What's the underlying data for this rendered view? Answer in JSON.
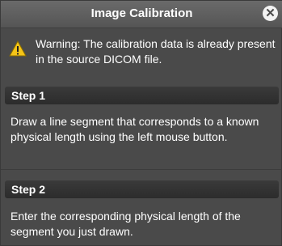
{
  "dialog": {
    "title": "Image Calibration",
    "close_symbol": "✕",
    "close_icon": "close-icon"
  },
  "warning": {
    "icon": "warning-icon",
    "icon_color": "#f5c518",
    "text": "Warning: The calibration data is already present in the source DICOM file."
  },
  "steps": [
    {
      "header": "Step 1",
      "text": "Draw a line segment that corresponds to a known physical length using the left mouse button."
    },
    {
      "header": "Step 2",
      "text": "Enter the corresponding physical length of the segment you just drawn."
    }
  ]
}
